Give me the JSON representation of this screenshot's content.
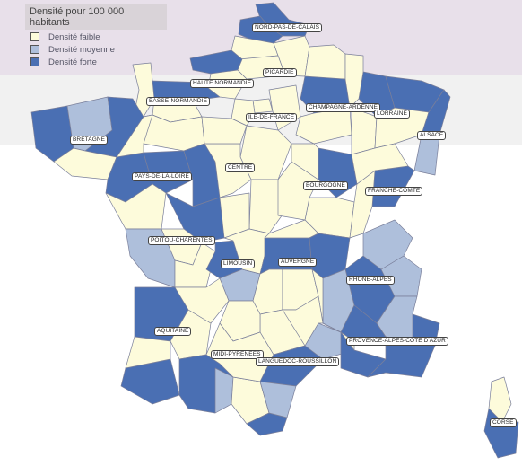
{
  "legend": {
    "title": "Densité pour 100 000 habitants",
    "items": [
      {
        "label": "Densité faible",
        "color": "#fdfbdb"
      },
      {
        "label": "Densité moyenne",
        "color": "#aebfdb"
      },
      {
        "label": "Densité forte",
        "color": "#4a6fb3"
      }
    ]
  },
  "colors": {
    "low": "#fdfbdb",
    "mid": "#aebfdb",
    "high": "#4a6fb3",
    "border": "#7a7f9a"
  },
  "regions": [
    {
      "key": "nord",
      "label": "NORD-PAS-DE-CALAIS"
    },
    {
      "key": "picardie",
      "label": "PICARDIE"
    },
    {
      "key": "haute-normandie",
      "label": "HAUTE NORMANDIE"
    },
    {
      "key": "basse-normandie",
      "label": "BASSE-NORMANDIE"
    },
    {
      "key": "ile-de-france",
      "label": "ILE-DE-FRANCE"
    },
    {
      "key": "champagne",
      "label": "CHAMPAGNE-ARDENNE"
    },
    {
      "key": "lorraine",
      "label": "LORRAINE"
    },
    {
      "key": "alsace",
      "label": "ALSACE"
    },
    {
      "key": "bretagne",
      "label": "BRETAGNE"
    },
    {
      "key": "pays-de-la-loire",
      "label": "PAYS-DE-LA-LOIRE"
    },
    {
      "key": "centre",
      "label": "CENTRE"
    },
    {
      "key": "bourgogne",
      "label": "BOURGOGNE"
    },
    {
      "key": "franche-comte",
      "label": "FRANCHE-COMTE"
    },
    {
      "key": "poitou",
      "label": "POITOU-CHARENTES"
    },
    {
      "key": "limousin",
      "label": "LIMOUSIN"
    },
    {
      "key": "auvergne",
      "label": "AUVERGNE"
    },
    {
      "key": "rhone-alpes",
      "label": "RHONE-ALPES"
    },
    {
      "key": "aquitaine",
      "label": "AQUITAINE"
    },
    {
      "key": "midi-pyrenees",
      "label": "MIDI-PYRENEES"
    },
    {
      "key": "languedoc",
      "label": "LANGUEDOC-ROUSSILLON"
    },
    {
      "key": "paca",
      "label": "PROVENCE-ALPES-COTE D'AZUR"
    },
    {
      "key": "corse",
      "label": "CORSE"
    }
  ],
  "departments": [
    {
      "code": "59",
      "density": "high"
    },
    {
      "code": "62",
      "density": "high"
    },
    {
      "code": "80",
      "density": "low"
    },
    {
      "code": "02",
      "density": "low"
    },
    {
      "code": "60",
      "density": "low"
    },
    {
      "code": "76",
      "density": "high"
    },
    {
      "code": "27",
      "density": "low"
    },
    {
      "code": "14",
      "density": "high"
    },
    {
      "code": "50",
      "density": "low"
    },
    {
      "code": "61",
      "density": "low"
    },
    {
      "code": "75",
      "density": "low"
    },
    {
      "code": "77",
      "density": "low"
    },
    {
      "code": "78",
      "density": "low"
    },
    {
      "code": "51",
      "density": "high"
    },
    {
      "code": "08",
      "density": "low"
    },
    {
      "code": "10",
      "density": "low"
    },
    {
      "code": "52",
      "density": "low"
    },
    {
      "code": "54",
      "density": "high"
    },
    {
      "code": "57",
      "density": "high"
    },
    {
      "code": "55",
      "density": "low"
    },
    {
      "code": "88",
      "density": "low"
    },
    {
      "code": "67",
      "density": "high"
    },
    {
      "code": "68",
      "density": "mid"
    },
    {
      "code": "29",
      "density": "high"
    },
    {
      "code": "22",
      "density": "mid"
    },
    {
      "code": "35",
      "density": "high"
    },
    {
      "code": "56",
      "density": "low"
    },
    {
      "code": "44",
      "density": "high"
    },
    {
      "code": "49",
      "density": "high"
    },
    {
      "code": "72",
      "density": "low"
    },
    {
      "code": "53",
      "density": "low"
    },
    {
      "code": "85",
      "density": "low"
    },
    {
      "code": "45",
      "density": "low"
    },
    {
      "code": "37",
      "density": "high"
    },
    {
      "code": "18",
      "density": "low"
    },
    {
      "code": "36",
      "density": "low"
    },
    {
      "code": "41",
      "density": "low"
    },
    {
      "code": "28",
      "density": "low"
    },
    {
      "code": "21",
      "density": "high"
    },
    {
      "code": "71",
      "density": "low"
    },
    {
      "code": "58",
      "density": "low"
    },
    {
      "code": "89",
      "density": "low"
    },
    {
      "code": "25",
      "density": "high"
    },
    {
      "code": "39",
      "density": "low"
    },
    {
      "code": "70",
      "density": "low"
    },
    {
      "code": "86",
      "density": "high"
    },
    {
      "code": "17",
      "density": "mid"
    },
    {
      "code": "79",
      "density": "low"
    },
    {
      "code": "16",
      "density": "low"
    },
    {
      "code": "87",
      "density": "high"
    },
    {
      "code": "19",
      "density": "mid"
    },
    {
      "code": "23",
      "density": "low"
    },
    {
      "code": "63",
      "density": "high"
    },
    {
      "code": "03",
      "density": "low"
    },
    {
      "code": "15",
      "density": "low"
    },
    {
      "code": "43",
      "density": "low"
    },
    {
      "code": "69",
      "density": "high"
    },
    {
      "code": "38",
      "density": "high"
    },
    {
      "code": "73",
      "density": "mid"
    },
    {
      "code": "74",
      "density": "mid"
    },
    {
      "code": "26",
      "density": "mid"
    },
    {
      "code": "42",
      "density": "low"
    },
    {
      "code": "33",
      "density": "high"
    },
    {
      "code": "64",
      "density": "high"
    },
    {
      "code": "40",
      "density": "low"
    },
    {
      "code": "47",
      "density": "low"
    },
    {
      "code": "24",
      "density": "low"
    },
    {
      "code": "31",
      "density": "high"
    },
    {
      "code": "65",
      "density": "mid"
    },
    {
      "code": "09",
      "density": "low"
    },
    {
      "code": "12",
      "density": "low"
    },
    {
      "code": "46",
      "density": "low"
    },
    {
      "code": "81",
      "density": "low"
    },
    {
      "code": "34",
      "density": "high"
    },
    {
      "code": "30",
      "density": "mid"
    },
    {
      "code": "66",
      "density": "high"
    },
    {
      "code": "11",
      "density": "mid"
    },
    {
      "code": "48",
      "density": "low"
    },
    {
      "code": "13",
      "density": "high"
    },
    {
      "code": "06",
      "density": "high"
    },
    {
      "code": "04",
      "density": "mid"
    },
    {
      "code": "05",
      "density": "high"
    },
    {
      "code": "84",
      "density": "low"
    },
    {
      "code": "83",
      "density": "high"
    },
    {
      "code": "2A",
      "density": "high"
    },
    {
      "code": "2B",
      "density": "low"
    }
  ]
}
